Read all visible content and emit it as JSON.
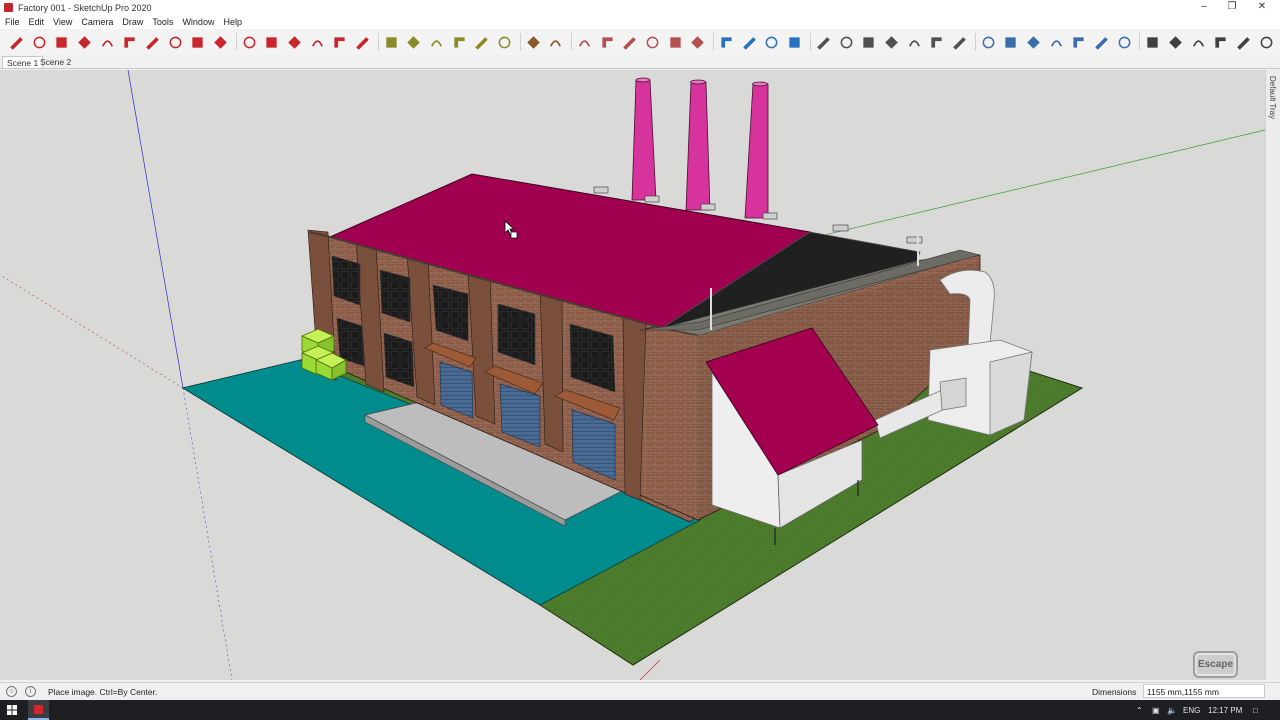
{
  "window": {
    "title": "Factory 001 - SketchUp Pro 2020",
    "controls": [
      "minimize-icon",
      "restore-icon",
      "close-icon"
    ]
  },
  "menu": [
    "File",
    "Edit",
    "View",
    "Camera",
    "Draw",
    "Tools",
    "Window",
    "Help"
  ],
  "toolbar": {
    "groups": [
      [
        "pencil-icon",
        "freehand-icon",
        "rectangle-icon",
        "rotated-rectangle-icon",
        "circle-icon",
        "polygon-icon",
        "arc-icon",
        "two-point-arc-icon",
        "three-point-arc-icon",
        "pie-icon"
      ],
      [
        "move-icon",
        "push-pull-icon",
        "rotate-icon",
        "follow-me-icon",
        "scale-icon",
        "offset-icon"
      ],
      [
        "tape-measure-icon",
        "dimension-icon",
        "protractor-icon",
        "text-icon",
        "axes-icon",
        "3d-text-icon"
      ],
      [
        "paint-bucket-icon",
        "eraser-icon"
      ],
      [
        "sandbox-from-contours-icon",
        "sandbox-from-scratch-icon",
        "smoove-icon",
        "stamp-icon",
        "drape-icon",
        "add-detail-icon"
      ],
      [
        "orbit-icon",
        "pan-icon",
        "zoom-icon",
        "zoom-window-icon"
      ],
      [
        "iso-view-icon",
        "top-view-icon",
        "front-view-icon",
        "right-view-icon",
        "back-view-icon",
        "left-view-icon",
        "bottom-view-icon"
      ],
      [
        "xray-icon",
        "back-edges-icon",
        "wireframe-icon",
        "hidden-line-icon",
        "shaded-icon",
        "shaded-textures-icon",
        "monochrome-icon"
      ],
      [
        "warehouse-icon",
        "extension-warehouse-icon",
        "home-icon",
        "outliner-icon",
        "house-icon",
        "components-icon"
      ]
    ]
  },
  "scenes": {
    "tabs": [
      "Scene 1",
      "Scene 2"
    ],
    "active": "Scene 1"
  },
  "viewport": {
    "background": "#d9d9d7",
    "model_colors": {
      "roof": "#a0004f",
      "chimney": "#d6339c",
      "lawn": "#4a7a2a",
      "parking": "#008c8c",
      "brick": "#8a5a45",
      "crates": "#9bd934"
    },
    "escape_badge": "Escape"
  },
  "tray": {
    "label": "Default Tray"
  },
  "status": {
    "message": "Place image. Ctrl=By Center.",
    "measure_label": "Dimensions",
    "measure_value": "1155 mm,1155 mm"
  },
  "taskbar": {
    "language": "ENG",
    "time": "12:17 PM"
  }
}
